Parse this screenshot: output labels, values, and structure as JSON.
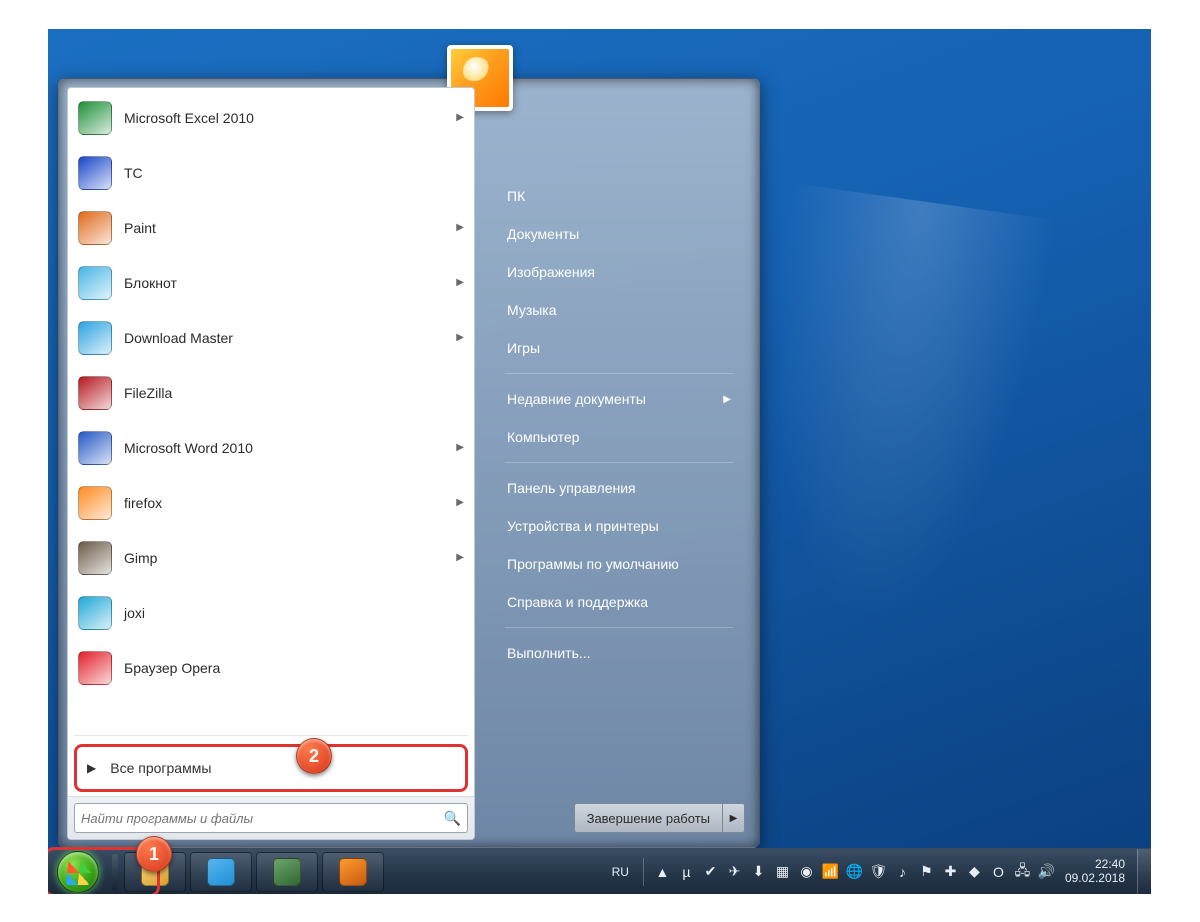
{
  "annotations": {
    "badge1": "1",
    "badge2": "2"
  },
  "start_menu": {
    "apps": [
      {
        "label": "Microsoft Excel 2010",
        "icon": "excel",
        "submenu": true
      },
      {
        "label": "TC",
        "icon": "totalcmd",
        "submenu": false
      },
      {
        "label": "Paint",
        "icon": "paint",
        "submenu": true
      },
      {
        "label": "Блокнот",
        "icon": "notepad",
        "submenu": true
      },
      {
        "label": "Download Master",
        "icon": "dm",
        "submenu": true
      },
      {
        "label": "FileZilla",
        "icon": "filezilla",
        "submenu": false
      },
      {
        "label": "Microsoft Word 2010",
        "icon": "word",
        "submenu": true
      },
      {
        "label": "firefox",
        "icon": "firefox",
        "submenu": true
      },
      {
        "label": "Gimp",
        "icon": "gimp",
        "submenu": true
      },
      {
        "label": "joxi",
        "icon": "joxi",
        "submenu": false
      },
      {
        "label": "Браузер Opera",
        "icon": "opera",
        "submenu": false
      }
    ],
    "all_programs": "Все программы",
    "search_placeholder": "Найти программы и файлы",
    "right_links": [
      {
        "label": "ПК",
        "submenu": false
      },
      {
        "label": "Документы",
        "submenu": false
      },
      {
        "label": "Изображения",
        "submenu": false
      },
      {
        "label": "Музыка",
        "submenu": false
      },
      {
        "label": "Игры",
        "submenu": false
      },
      {
        "label": "Недавние документы",
        "submenu": true
      },
      {
        "label": "Компьютер",
        "submenu": false
      },
      {
        "label": "Панель управления",
        "submenu": false
      },
      {
        "label": "Устройства и принтеры",
        "submenu": false
      },
      {
        "label": "Программы по умолчанию",
        "submenu": false
      },
      {
        "label": "Справка и поддержка",
        "submenu": false
      },
      {
        "label": "Выполнить...",
        "submenu": false
      }
    ],
    "right_separators_after": [
      4,
      6,
      10
    ],
    "shutdown_label": "Завершение работы"
  },
  "taskbar": {
    "pinned": [
      {
        "name": "explorer",
        "color1": "#ffe08a",
        "color2": "#d99b2a"
      },
      {
        "name": "telegram",
        "color1": "#58b6ef",
        "color2": "#1e8fd6"
      },
      {
        "name": "task-manager",
        "color1": "#6fa36f",
        "color2": "#2f6a2f"
      },
      {
        "name": "firefox",
        "color1": "#ff9b2f",
        "color2": "#c65a10"
      }
    ],
    "lang": "RU",
    "tray_icons": [
      "up",
      "utorrent",
      "check",
      "telegram",
      "dm",
      "skrn",
      "nvidia",
      "wifi",
      "globe",
      "av",
      "sound2",
      "flag",
      "joxi",
      "adguard",
      "opera",
      "net",
      "vol"
    ],
    "time": "22:40",
    "date": "09.02.2018"
  },
  "icon_colors": {
    "excel": "#1f8f3b",
    "totalcmd": "#1846c9",
    "paint": "#e06a1a",
    "notepad": "#48b6e6",
    "dm": "#2aa4e0",
    "filezilla": "#b51820",
    "word": "#2457c5",
    "firefox": "#ff8a1f",
    "gimp": "#6b5b47",
    "joxi": "#1fa9d8",
    "opera": "#e3202b"
  }
}
